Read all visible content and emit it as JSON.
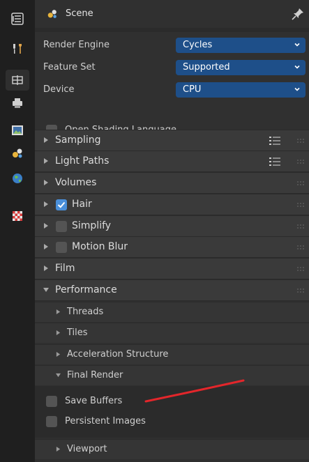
{
  "header": {
    "title": "Scene",
    "icons": [
      "scene-icon",
      "pin-icon"
    ]
  },
  "sidebar_tabs": [
    {
      "name": "tool-tab",
      "icon": "tool-icon",
      "active": false
    },
    {
      "name": "render-tab",
      "icon": "render-icon",
      "active": true
    },
    {
      "name": "output-tab",
      "icon": "output-printer-icon",
      "active": false
    },
    {
      "name": "view-layer-tab",
      "icon": "view-layer-icon",
      "active": false
    },
    {
      "name": "scene-tab",
      "icon": "scene-icon",
      "active": false
    },
    {
      "name": "world-tab",
      "icon": "world-icon",
      "active": false
    },
    {
      "name": "texture-tab",
      "icon": "checker-texture-icon",
      "active": false
    }
  ],
  "properties": {
    "render_engine": {
      "label": "Render Engine",
      "value": "Cycles"
    },
    "feature_set": {
      "label": "Feature Set",
      "value": "Supported"
    },
    "device": {
      "label": "Device",
      "value": "CPU"
    },
    "osl": {
      "label": "Open Shading Language",
      "checked": false
    }
  },
  "sections": [
    {
      "title": "Sampling",
      "expanded": false,
      "has_checkbox": false,
      "has_list_icon": true
    },
    {
      "title": "Light Paths",
      "expanded": false,
      "has_checkbox": false,
      "has_list_icon": true
    },
    {
      "title": "Volumes",
      "expanded": false,
      "has_checkbox": false,
      "has_list_icon": false
    },
    {
      "title": "Hair",
      "expanded": false,
      "has_checkbox": true,
      "checked": true,
      "has_list_icon": false
    },
    {
      "title": "Simplify",
      "expanded": false,
      "has_checkbox": true,
      "checked": false,
      "has_list_icon": false
    },
    {
      "title": "Motion Blur",
      "expanded": false,
      "has_checkbox": true,
      "checked": false,
      "has_list_icon": false
    },
    {
      "title": "Film",
      "expanded": false,
      "has_checkbox": false,
      "has_list_icon": false
    },
    {
      "title": "Performance",
      "expanded": true,
      "has_checkbox": false,
      "has_list_icon": false
    }
  ],
  "performance_subsections": [
    {
      "title": "Threads",
      "expanded": false
    },
    {
      "title": "Tiles",
      "expanded": false
    },
    {
      "title": "Acceleration Structure",
      "expanded": false
    },
    {
      "title": "Final Render",
      "expanded": true
    },
    {
      "title": "Viewport",
      "expanded": false
    }
  ],
  "final_render_options": [
    {
      "label": "Save Buffers",
      "checked": false
    },
    {
      "label": "Persistent Images",
      "checked": false
    }
  ],
  "colors": {
    "accent_blue": "#1e4f89",
    "checkbox_checked": "#4a8fd9",
    "annotation_red": "#e3262b"
  }
}
